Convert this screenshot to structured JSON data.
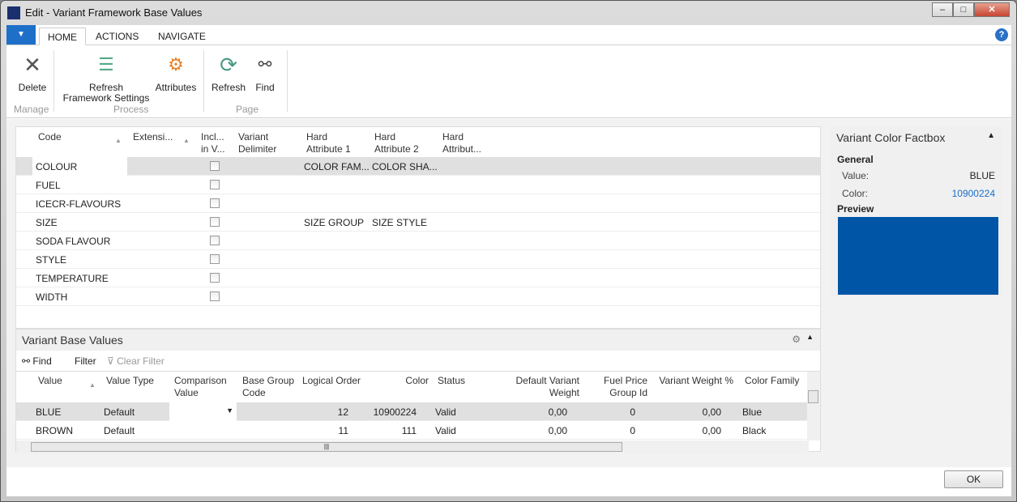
{
  "window": {
    "title": "Edit - Variant Framework Base Values"
  },
  "tabs": [
    "HOME",
    "ACTIONS",
    "NAVIGATE"
  ],
  "ribbon": {
    "delete": "Delete",
    "refresh_framework": "Refresh\nFramework Settings",
    "refresh_framework_1": "Refresh",
    "refresh_framework_2": "Framework Settings",
    "attributes": "Attributes",
    "refresh": "Refresh",
    "find": "Find",
    "groups": {
      "manage": "Manage",
      "process": "Process",
      "page": "Page"
    }
  },
  "main_grid": {
    "headers": [
      "Code",
      "Extensi...",
      "Incl... in V...",
      "Variant Delimiter",
      "Hard Attribute 1",
      "Hard Attribute 2",
      "Hard Attribut..."
    ],
    "headers_split": [
      [
        "Code",
        ""
      ],
      [
        "Extensi...",
        ""
      ],
      [
        "Incl...",
        "in V..."
      ],
      [
        "Variant",
        "Delimiter"
      ],
      [
        "Hard",
        "Attribute 1"
      ],
      [
        "Hard",
        "Attribute 2"
      ],
      [
        "Hard",
        "Attribut..."
      ]
    ],
    "rows": [
      {
        "code": "COLOUR",
        "attr1": "COLOR FAM...",
        "attr2": "COLOR SHA..."
      },
      {
        "code": "FUEL",
        "attr1": "",
        "attr2": ""
      },
      {
        "code": "ICECR-FLAVOURS",
        "attr1": "",
        "attr2": ""
      },
      {
        "code": "SIZE",
        "attr1": "SIZE GROUP",
        "attr2": "SIZE STYLE"
      },
      {
        "code": "SODA FLAVOUR",
        "attr1": "",
        "attr2": ""
      },
      {
        "code": "STYLE",
        "attr1": "",
        "attr2": ""
      },
      {
        "code": "TEMPERATURE",
        "attr1": "",
        "attr2": ""
      },
      {
        "code": "WIDTH",
        "attr1": "",
        "attr2": ""
      }
    ]
  },
  "factbox": {
    "title": "Variant Color Factbox",
    "general": "General",
    "value_label": "Value:",
    "value": "BLUE",
    "color_label": "Color:",
    "color": "10900224",
    "preview": "Preview",
    "preview_color": "#0055A6"
  },
  "subpage": {
    "title": "Variant Base Values",
    "find": "Find",
    "filter": "Filter",
    "clear_filter": "Clear Filter",
    "headers": [
      [
        "Value",
        ""
      ],
      [
        "Value Type",
        ""
      ],
      [
        "Comparison",
        "Value"
      ],
      [
        "Base Group",
        "Code"
      ],
      [
        "Logical Order",
        ""
      ],
      [
        "Color",
        ""
      ],
      [
        "Status",
        ""
      ],
      [
        "Default Variant",
        "Weight"
      ],
      [
        "Fuel Price",
        "Group Id"
      ],
      [
        "Variant Weight %",
        ""
      ],
      [
        "Color Family",
        ""
      ]
    ],
    "rows": [
      {
        "value": "BLUE",
        "type": "Default",
        "comparison": "",
        "base": "",
        "order": "12",
        "color": "10900224",
        "status": "Valid",
        "weight": "0,00",
        "fuel": "0",
        "vw": "0,00",
        "family": "Blue"
      },
      {
        "value": "BROWN",
        "type": "Default",
        "comparison": "",
        "base": "",
        "order": "11",
        "color": "111",
        "status": "Valid",
        "weight": "0,00",
        "fuel": "0",
        "vw": "0,00",
        "family": "Black"
      }
    ]
  },
  "ok": "OK"
}
